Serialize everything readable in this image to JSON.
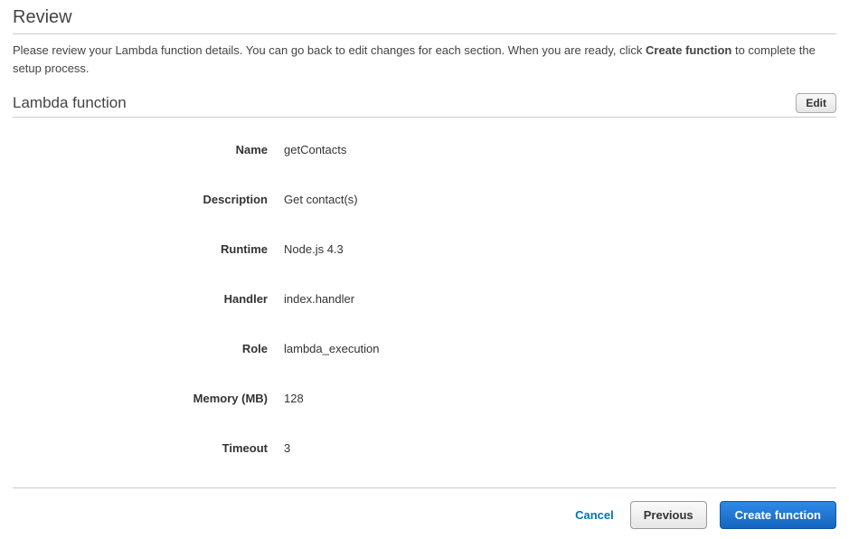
{
  "header": {
    "title": "Review",
    "intro_a": "Please review your Lambda function details. You can go back to edit changes for each section. When you are ready, click ",
    "intro_strong": "Create function",
    "intro_b": " to complete the setup process."
  },
  "section": {
    "title": "Lambda function",
    "edit_label": "Edit"
  },
  "fields": {
    "name": {
      "label": "Name",
      "value": "getContacts"
    },
    "description": {
      "label": "Description",
      "value": "Get contact(s)"
    },
    "runtime": {
      "label": "Runtime",
      "value": "Node.js 4.3"
    },
    "handler": {
      "label": "Handler",
      "value": "index.handler"
    },
    "role": {
      "label": "Role",
      "value": "lambda_execution"
    },
    "memory": {
      "label": "Memory (MB)",
      "value": "128"
    },
    "timeout": {
      "label": "Timeout",
      "value": "3"
    }
  },
  "buttons": {
    "cancel": "Cancel",
    "previous": "Previous",
    "create": "Create function"
  }
}
